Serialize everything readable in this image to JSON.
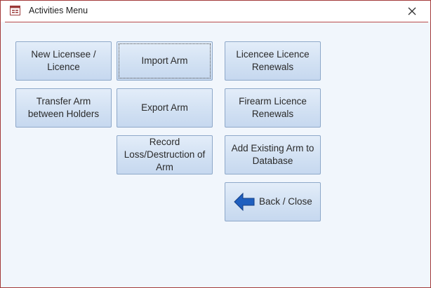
{
  "window": {
    "title": "Activities Menu"
  },
  "buttons": {
    "new_licensee": "New Licensee / Licence",
    "import_arm": "Import Arm",
    "licencee_renewals": "Licencee Licence Renewals",
    "transfer_arm": "Transfer Arm between Holders",
    "export_arm": "Export Arm",
    "firearm_renewals": "Firearm Licence Renewals",
    "record_loss": "Record Loss/Destruction of Arm",
    "add_existing": "Add Existing Arm to Database",
    "back_close": "Back / Close"
  },
  "icons": {
    "title_icon": "form-icon",
    "close": "close-icon",
    "back": "back-arrow-icon"
  },
  "colors": {
    "window_border": "#a33a3a",
    "button_border": "#8ea8c9",
    "arrow": "#1f5fbf"
  }
}
